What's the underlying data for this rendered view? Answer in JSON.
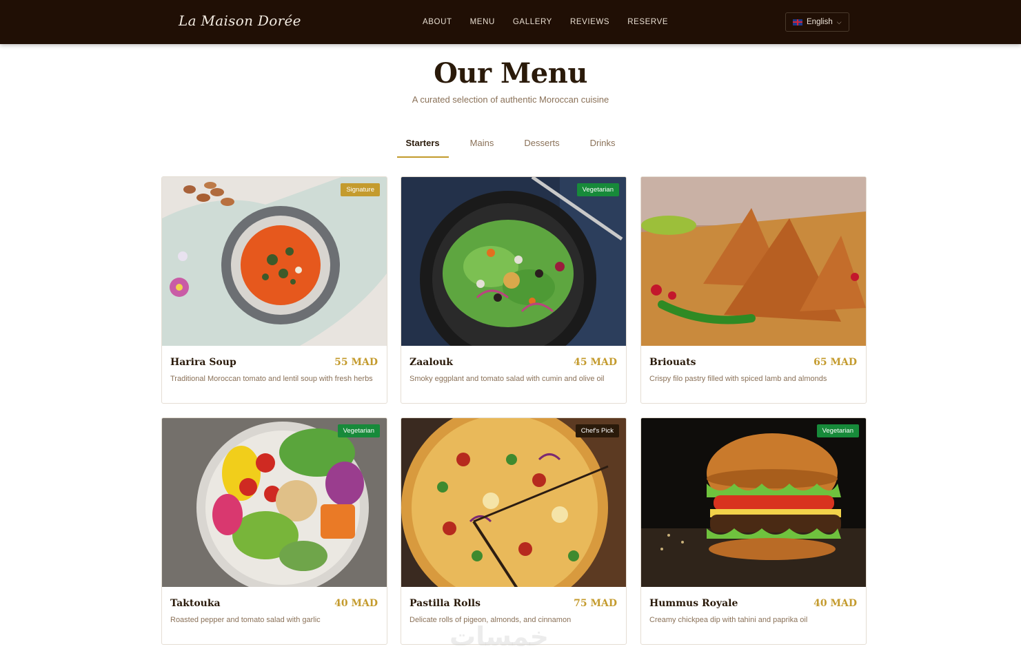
{
  "nav": {
    "logo": "La Maison Dorée",
    "links": [
      "ABOUT",
      "MENU",
      "GALLERY",
      "REVIEWS",
      "RESERVE"
    ],
    "language": "English"
  },
  "header": {
    "title": "Our Menu",
    "subtitle": "A curated selection of authentic Moroccan cuisine"
  },
  "tabs": [
    "Starters",
    "Mains",
    "Desserts",
    "Drinks"
  ],
  "active_tab": "Starters",
  "items": [
    {
      "name": "Harira Soup",
      "price": "55 MAD",
      "desc": "Traditional Moroccan tomato and lentil soup with fresh herbs",
      "badge": "Signature",
      "badge_color": "#c49b2e",
      "image": "soup-bowl"
    },
    {
      "name": "Zaalouk",
      "price": "45 MAD",
      "desc": "Smoky eggplant and tomato salad with cumin and olive oil",
      "badge": "Vegetarian",
      "badge_color": "#178a3a",
      "image": "salad-plate"
    },
    {
      "name": "Briouats",
      "price": "65 MAD",
      "desc": "Crispy filo pastry filled with spiced lamb and almonds",
      "badge": "",
      "badge_color": "",
      "image": "samosas"
    },
    {
      "name": "Taktouka",
      "price": "40 MAD",
      "desc": "Roasted pepper and tomato salad with garlic",
      "badge": "Vegetarian",
      "badge_color": "#178a3a",
      "image": "veggie-bowl"
    },
    {
      "name": "Pastilla Rolls",
      "price": "75 MAD",
      "desc": "Delicate rolls of pigeon, almonds, and cinnamon",
      "badge": "Chef's Pick",
      "badge_color": "#2a1a0a",
      "image": "pizza"
    },
    {
      "name": "Hummus Royale",
      "price": "40 MAD",
      "desc": "Creamy chickpea dip with tahini and paprika oil",
      "badge": "Vegetarian",
      "badge_color": "#178a3a",
      "image": "burger"
    }
  ],
  "watermark": "خمسات"
}
